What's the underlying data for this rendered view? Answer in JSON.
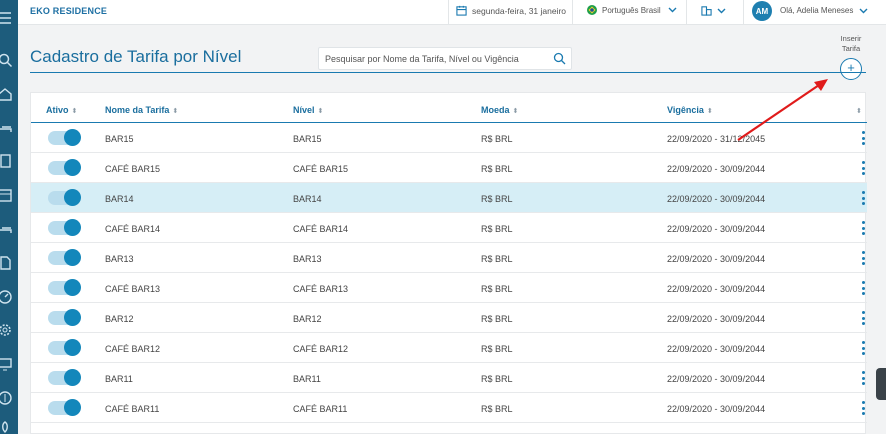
{
  "app": {
    "brand": "EKO RESIDENCE",
    "date": "segunda-feira, 31 janeiro",
    "language": "Português Brasil",
    "user_initials": "AM",
    "greeting": "Olá, Adelia Meneses"
  },
  "page": {
    "title": "Cadastro de Tarifa por Nível",
    "search_placeholder": "Pesquisar por Nome da Tarifa, Nível ou Vigência",
    "insert_label_line1": "Inserir",
    "insert_label_line2": "Tarifa",
    "insert_symbol": "+"
  },
  "table": {
    "columns": [
      "Ativo",
      "Nome da Tarifa",
      "Nível",
      "Moeda",
      "Vigência"
    ],
    "rows": [
      {
        "active": true,
        "name": "BAR15",
        "level": "BAR15",
        "currency": "R$ BRL",
        "validity": "22/09/2020 - 31/12/2045",
        "selected": false
      },
      {
        "active": true,
        "name": "CAFÉ BAR15",
        "level": "CAFÉ BAR15",
        "currency": "R$ BRL",
        "validity": "22/09/2020 - 30/09/2044",
        "selected": false
      },
      {
        "active": true,
        "name": "BAR14",
        "level": "BAR14",
        "currency": "R$ BRL",
        "validity": "22/09/2020 - 30/09/2044",
        "selected": true
      },
      {
        "active": true,
        "name": "CAFÉ BAR14",
        "level": "CAFÉ BAR14",
        "currency": "R$ BRL",
        "validity": "22/09/2020 - 30/09/2044",
        "selected": false
      },
      {
        "active": true,
        "name": "BAR13",
        "level": "BAR13",
        "currency": "R$ BRL",
        "validity": "22/09/2020 - 30/09/2044",
        "selected": false
      },
      {
        "active": true,
        "name": "CAFÉ BAR13",
        "level": "CAFÉ BAR13",
        "currency": "R$ BRL",
        "validity": "22/09/2020 - 30/09/2044",
        "selected": false
      },
      {
        "active": true,
        "name": "BAR12",
        "level": "BAR12",
        "currency": "R$ BRL",
        "validity": "22/09/2020 - 30/09/2044",
        "selected": false
      },
      {
        "active": true,
        "name": "CAFÉ BAR12",
        "level": "CAFÉ BAR12",
        "currency": "R$ BRL",
        "validity": "22/09/2020 - 30/09/2044",
        "selected": false
      },
      {
        "active": true,
        "name": "BAR11",
        "level": "BAR11",
        "currency": "R$ BRL",
        "validity": "22/09/2020 - 30/09/2044",
        "selected": false
      },
      {
        "active": true,
        "name": "CAFÉ BAR11",
        "level": "CAFÉ BAR11",
        "currency": "R$ BRL",
        "validity": "22/09/2020 - 30/09/2044",
        "selected": false
      }
    ]
  },
  "icons": {
    "sidebar": [
      "menu-icon",
      "search-icon",
      "home-icon",
      "bed-icon",
      "building-icon",
      "calendar-icon",
      "bed-icon",
      "document-icon",
      "dashboard-icon",
      "settings-icon",
      "monitor-icon",
      "dollar-icon",
      "rocket-icon"
    ],
    "topbar": [
      "calendar-icon",
      "brazil-flag-icon",
      "chevron-down-icon",
      "buildings-icon",
      "chevron-down-icon"
    ]
  },
  "colors": {
    "accent": "#1a7ab0",
    "sidebar": "#1d5c7c",
    "selected_row": "#d6eef6",
    "toggle_on": "#1387bb",
    "annotation": "#e01b1b"
  }
}
